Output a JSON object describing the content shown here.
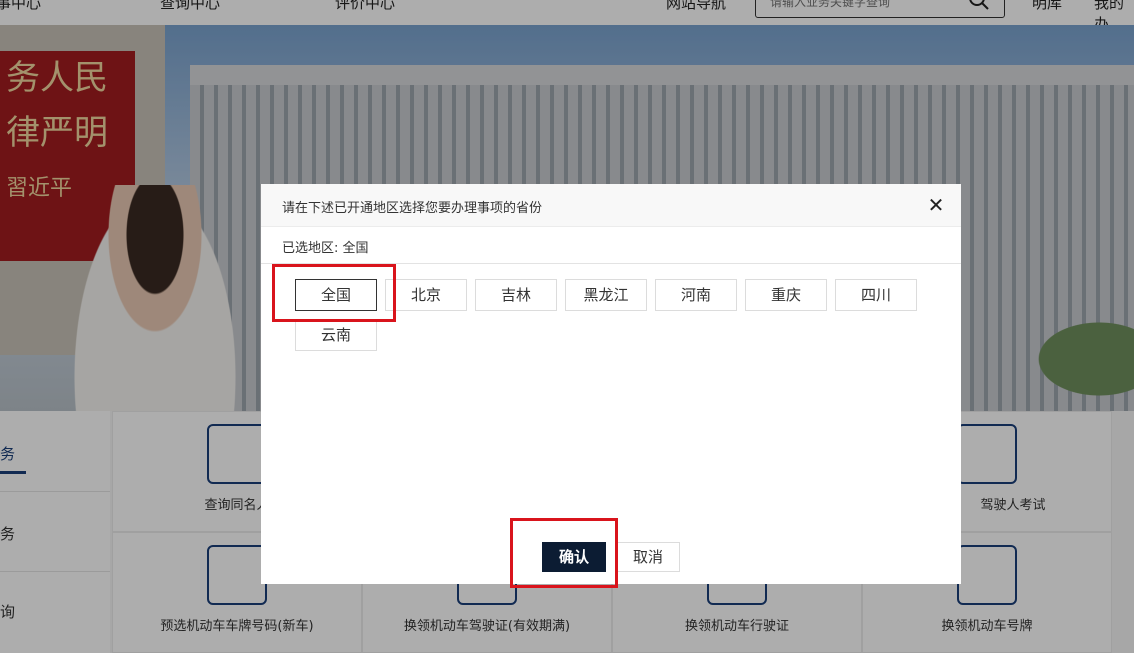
{
  "topnav": {
    "items": [
      "事中心",
      "查询中心",
      "评价中心",
      "网站导航"
    ],
    "search_placeholder": "请输入业务关键字查询",
    "right_links": [
      "明库",
      "我的办"
    ]
  },
  "banner": {
    "plaque_lines": [
      "务人民",
      "律严明",
      "習近平"
    ]
  },
  "side_menu": {
    "items": [
      "务",
      "务",
      "询"
    ]
  },
  "tiles": [
    {
      "label": "查询同名人"
    },
    {
      "label": "预选机动车车牌号码(新车)"
    },
    {
      "label": "换领机动车驾驶证(有效期满)"
    },
    {
      "label": "换领机动车行驶证"
    },
    {
      "label": "换领机动车号牌"
    },
    {
      "label": "驾驶人考试"
    }
  ],
  "modal": {
    "title": "请在下述已开通地区选择您要办理事项的省份",
    "close_icon": "close-icon",
    "selected_label": "已选地区: 全国",
    "regions": [
      "全国",
      "北京",
      "吉林",
      "黑龙江",
      "河南",
      "重庆",
      "四川",
      "云南"
    ],
    "selected_region": "全国",
    "confirm_label": "确认",
    "cancel_label": "取消"
  },
  "colors": {
    "highlight": "#d9141c",
    "confirm_bg": "#0c1c33",
    "brand_blue": "#1a3f7a"
  }
}
